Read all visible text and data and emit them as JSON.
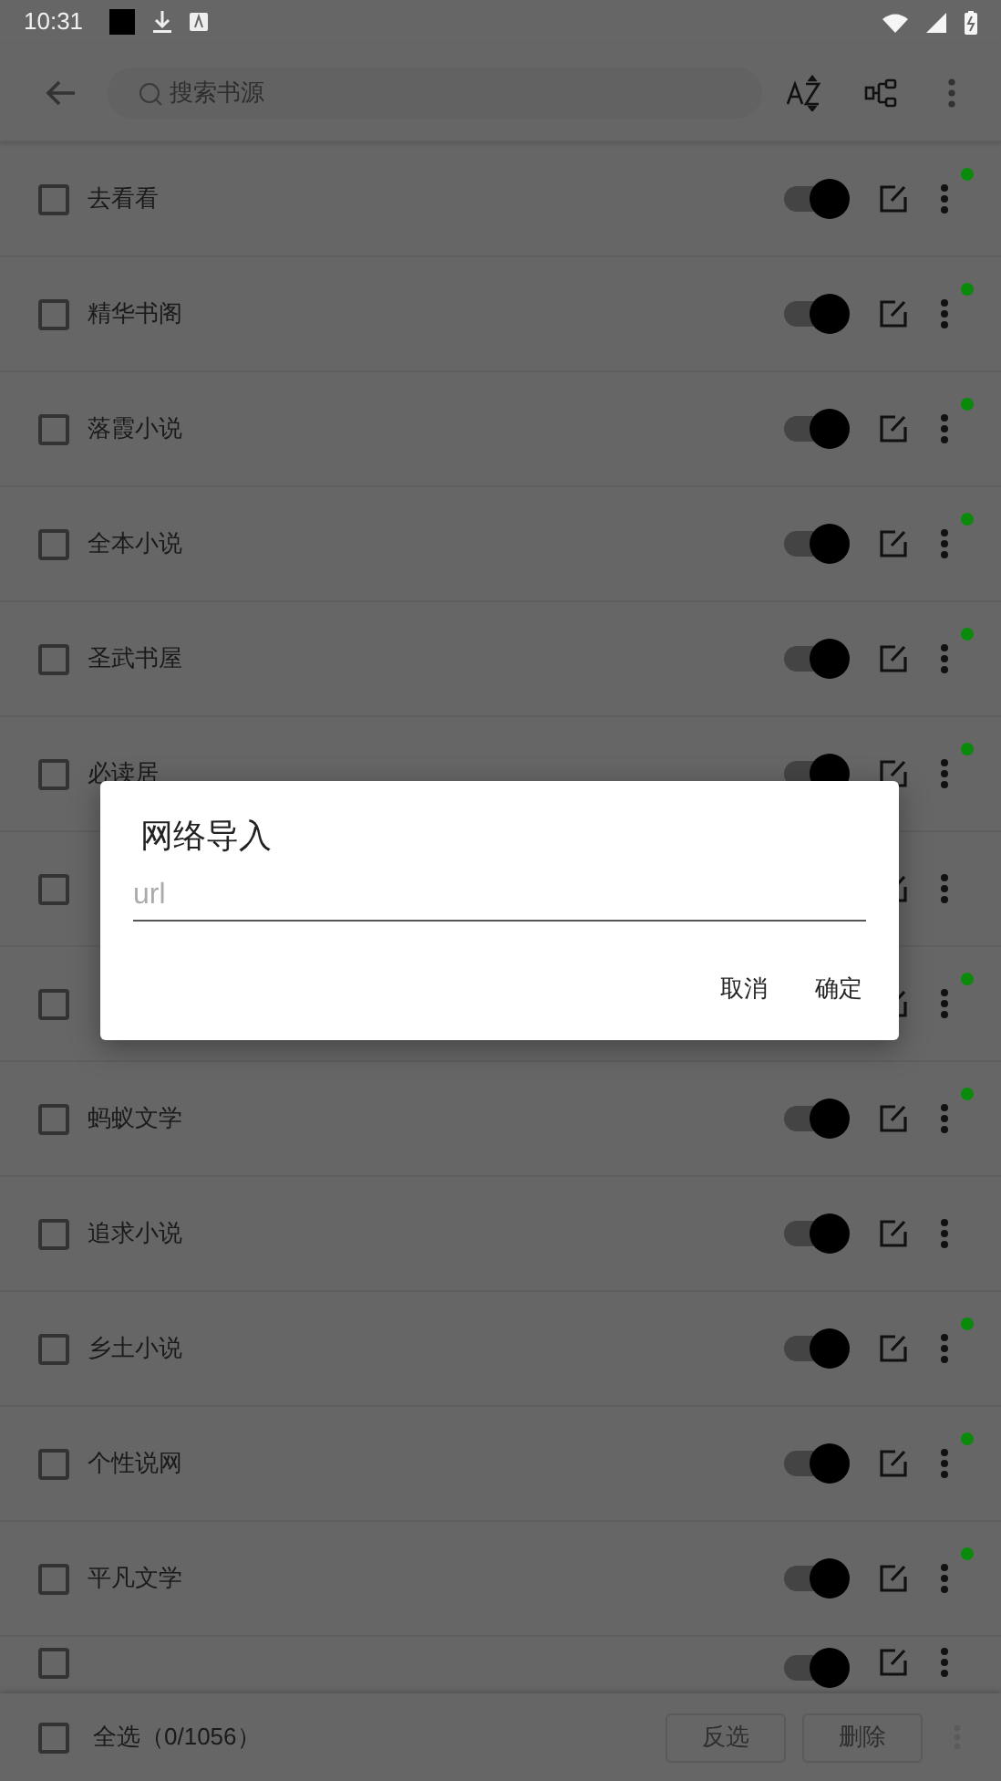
{
  "status_bar": {
    "time": "10:31"
  },
  "toolbar": {
    "search": {
      "placeholder": "搜索书源"
    }
  },
  "sources": [
    {
      "name": "去看看",
      "checked": false,
      "on": true,
      "dot": true
    },
    {
      "name": "精华书阁",
      "checked": false,
      "on": true,
      "dot": true
    },
    {
      "name": "落霞小说",
      "checked": false,
      "on": true,
      "dot": true
    },
    {
      "name": "全本小说",
      "checked": false,
      "on": true,
      "dot": true
    },
    {
      "name": "圣武书屋",
      "checked": false,
      "on": true,
      "dot": true
    },
    {
      "name": "必读居",
      "checked": false,
      "on": true,
      "dot": true
    },
    {
      "checked": false
    },
    {
      "checked": false,
      "dot": true
    },
    {
      "name": "蚂蚁文学",
      "checked": false,
      "on": true,
      "dot": true
    },
    {
      "name": "追求小说",
      "checked": false,
      "on": true,
      "dot": false
    },
    {
      "name": "乡土小说",
      "checked": false,
      "on": true,
      "dot": true
    },
    {
      "name": "个性说网",
      "checked": false,
      "on": true,
      "dot": true
    },
    {
      "name": "平凡文学",
      "checked": false,
      "on": true,
      "dot": true
    },
    {
      "checked": false,
      "on": true
    }
  ],
  "bottom_bar": {
    "select_all": {
      "label": "全选（0/1056）",
      "checked": false
    },
    "buttons": [
      "反选",
      "删除"
    ]
  },
  "dialog": {
    "title": "网络导入",
    "field": {
      "placeholder": "url"
    },
    "buttons": [
      "取消",
      "确定"
    ]
  }
}
